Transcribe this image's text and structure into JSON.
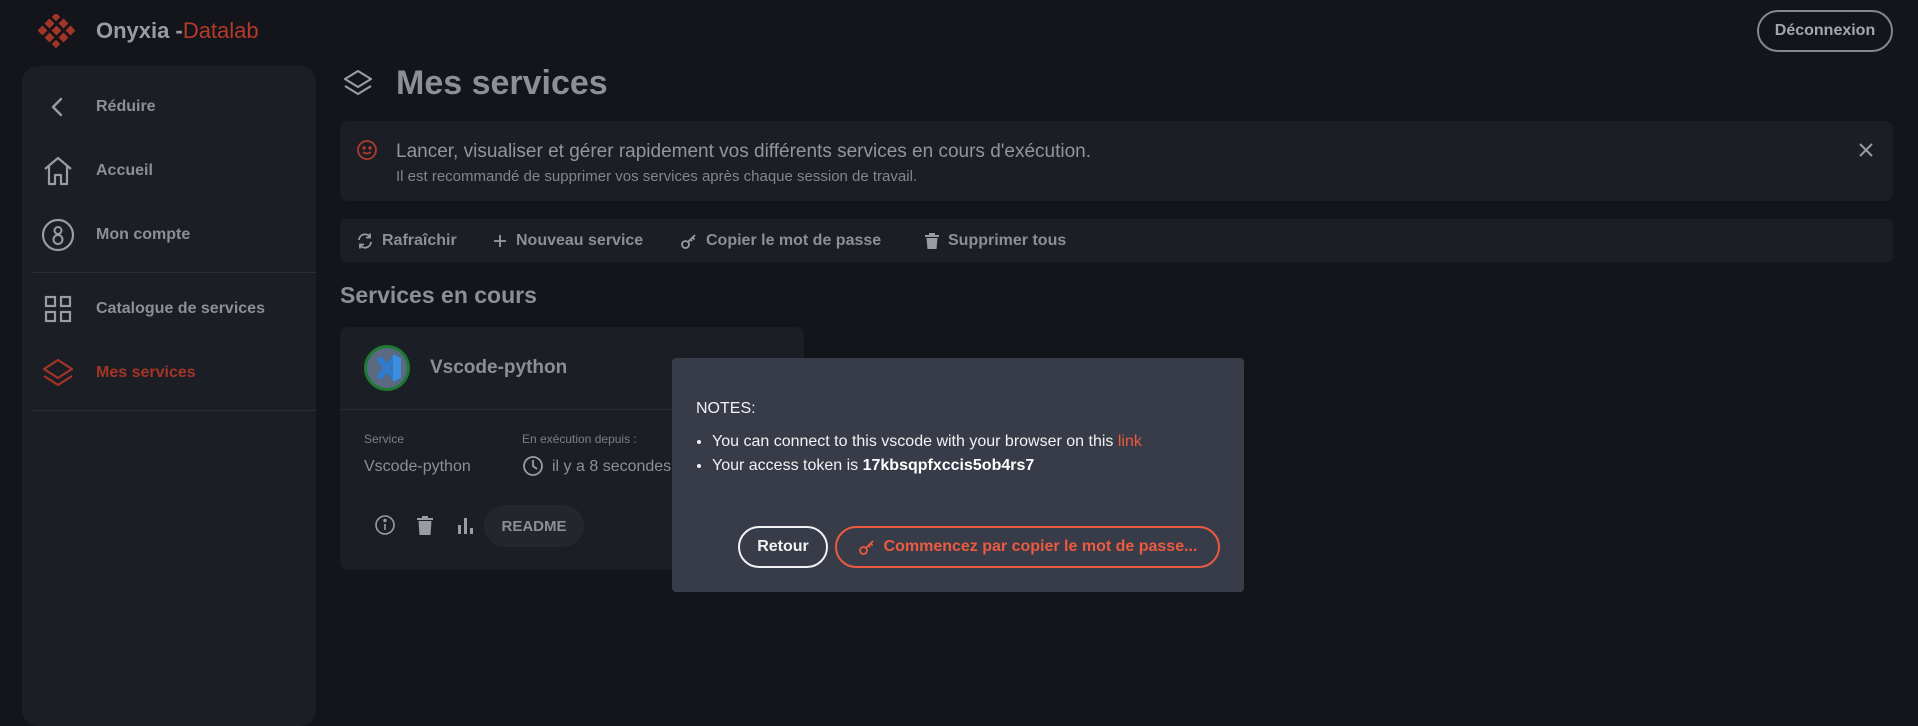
{
  "header": {
    "app_name": "Onyxia -",
    "brand": "Datalab",
    "logout_label": "Déconnexion",
    "brand_color": "#b53a2a"
  },
  "sidebar": {
    "items": [
      {
        "label": "Réduire",
        "icon": "chevron-left-icon"
      },
      {
        "label": "Accueil",
        "icon": "home-icon"
      },
      {
        "label": "Mon compte",
        "icon": "account-icon"
      },
      {
        "label": "Catalogue de services",
        "icon": "grid-icon"
      },
      {
        "label": "Mes services",
        "icon": "layers-icon",
        "active": true
      }
    ]
  },
  "main": {
    "title": "Mes services",
    "alert": {
      "message": "Lancer, visualiser et gérer rapidement vos différents services en cours d'exécution.",
      "sub": "Il est recommandé de supprimer vos services après chaque session de travail."
    },
    "toolbar": {
      "refresh": "Rafraîchir",
      "new_service": "Nouveau service",
      "copy_password": "Copier le mot de passe",
      "delete_all": "Supprimer tous"
    },
    "section_title": "Services en cours",
    "service_card": {
      "name": "Vscode-python",
      "service_key": "Service",
      "service_value": "Vscode-python",
      "running_key": "En exécution depuis :",
      "running_value": "il y a 8 secondes",
      "readme_label": "README"
    }
  },
  "dialog": {
    "notes_title": "NOTES:",
    "line1_text": "You can connect to this vscode with your browser on this ",
    "line1_link": "link",
    "line2_text": "Your access token is ",
    "token": "17kbsqpfxccis5ob4rs7",
    "back_label": "Retour",
    "copy_label": "Commencez par copier le mot de passe...",
    "accent_color": "#ec5a40"
  }
}
